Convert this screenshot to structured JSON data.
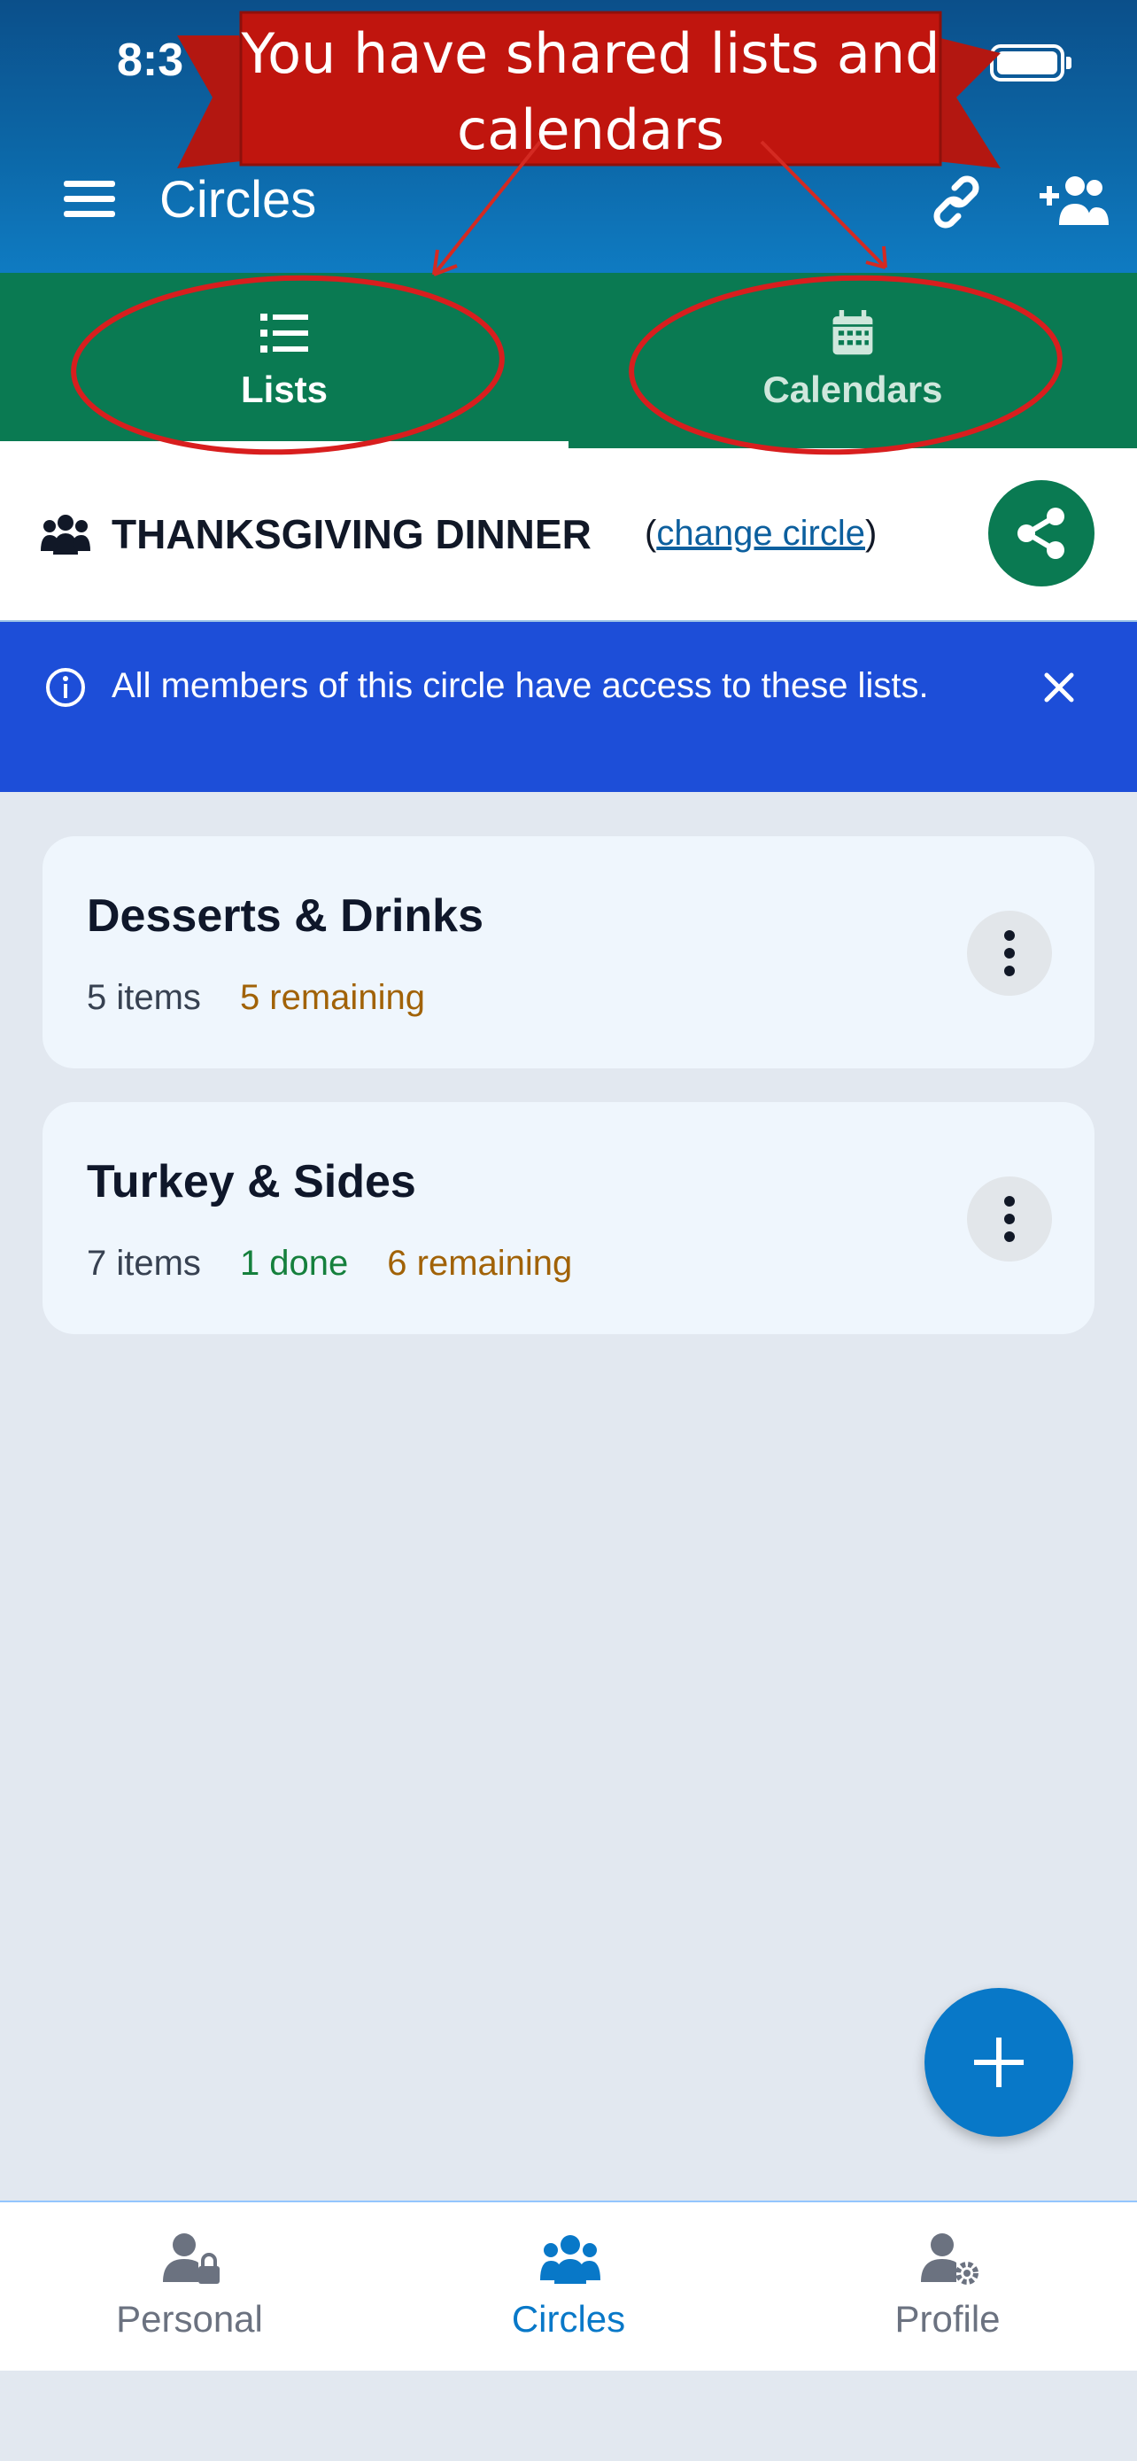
{
  "status_bar": {
    "time": "8:3"
  },
  "header": {
    "title": "Circles"
  },
  "tabs": [
    {
      "label": "Lists",
      "active": true
    },
    {
      "label": "Calendars",
      "active": false
    }
  ],
  "circle": {
    "name": "THANKSGIVING DINNER",
    "change_open": "(",
    "change_link": "change circle",
    "change_close": ")"
  },
  "info_banner": {
    "text": "All members of this circle have access to these lists."
  },
  "lists": [
    {
      "title": "Desserts & Drinks",
      "items": "5 items",
      "done": "",
      "remaining": "5 remaining"
    },
    {
      "title": "Turkey & Sides",
      "items": "7 items",
      "done": "1 done",
      "remaining": "6 remaining"
    }
  ],
  "bottom_nav": [
    {
      "label": "Personal"
    },
    {
      "label": "Circles",
      "active": true
    },
    {
      "label": "Profile"
    }
  ],
  "annotation": {
    "text": "You have shared lists and calendars"
  },
  "colors": {
    "header": "#0c67a7",
    "tabs": "#0a7a52",
    "banner": "#1d4ed8",
    "accent": "#0878c8",
    "annotation": "#c0150e",
    "done": "#15803d",
    "remaining": "#a16207"
  },
  "icons": [
    "menu-icon",
    "link-icon",
    "add-user-icon",
    "list-icon",
    "calendar-icon",
    "people-icon",
    "share-icon",
    "info-icon",
    "close-icon",
    "kebab-icon",
    "plus-icon",
    "user-lock-icon",
    "users-icon",
    "user-gear-icon",
    "battery-icon"
  ]
}
